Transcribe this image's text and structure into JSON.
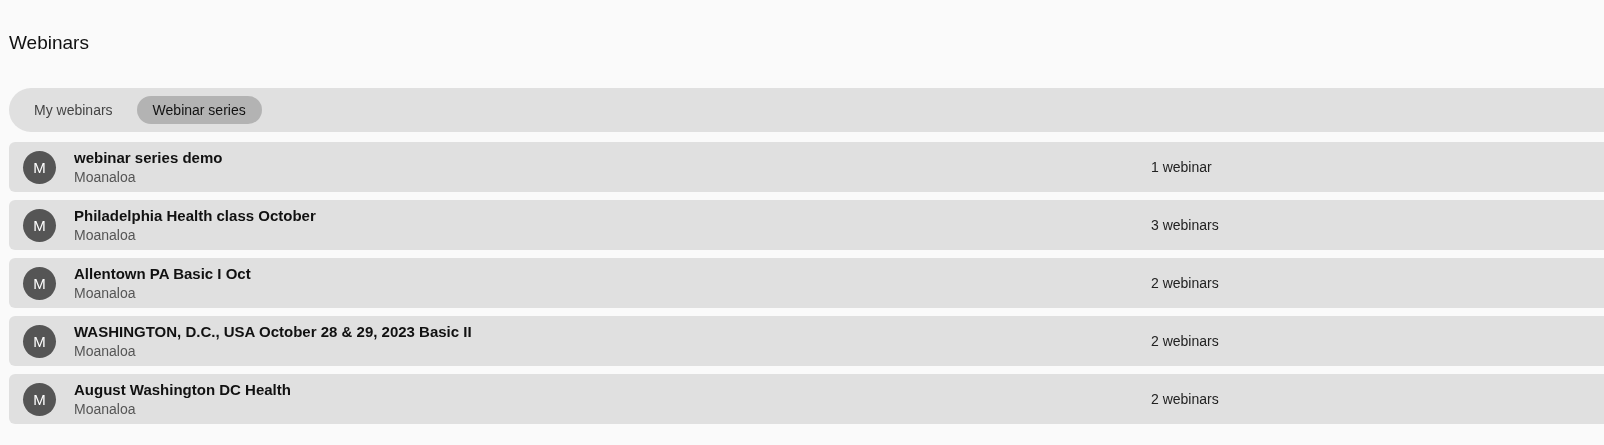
{
  "page_title": "Webinars",
  "tabs": [
    {
      "label": "My webinars",
      "selected": false
    },
    {
      "label": "Webinar series",
      "selected": true
    }
  ],
  "series": [
    {
      "avatar": "M",
      "title": "webinar series demo",
      "host": "Moanaloa",
      "count": "1 webinar"
    },
    {
      "avatar": "M",
      "title": "Philadelphia Health class October",
      "host": "Moanaloa",
      "count": "3 webinars"
    },
    {
      "avatar": "M",
      "title": "Allentown PA Basic I Oct",
      "host": "Moanaloa",
      "count": "2 webinars"
    },
    {
      "avatar": "M",
      "title": "WASHINGTON, D.C., USA October 28 & 29, 2023 Basic II",
      "host": "Moanaloa",
      "count": "2 webinars"
    },
    {
      "avatar": "M",
      "title": "August Washington DC Health",
      "host": "Moanaloa",
      "count": "2 webinars"
    }
  ]
}
